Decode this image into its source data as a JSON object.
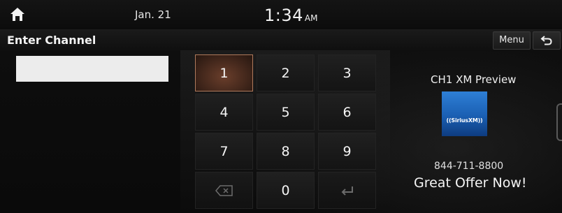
{
  "status": {
    "date": "Jan. 21",
    "time": "1:34",
    "ampm": "AM"
  },
  "header": {
    "title": "Enter Channel",
    "menu_label": "Menu"
  },
  "input": {
    "value": "",
    "placeholder": ""
  },
  "keypad": {
    "k1": "1",
    "k2": "2",
    "k3": "3",
    "k4": "4",
    "k5": "5",
    "k6": "6",
    "k7": "7",
    "k8": "8",
    "k9": "9",
    "k0": "0",
    "active_key": "1"
  },
  "channel": {
    "name": "CH1 XM Preview",
    "logo_text": "((SiriusXM))",
    "phone": "844-711-8800",
    "offer": "Great Offer Now!"
  },
  "colors": {
    "accent_key": "#6a3e2b",
    "logo_blue": "#2e7fd6",
    "background": "#0b0b0b"
  },
  "icons": {
    "home": "home-icon",
    "back": "back-arrow-icon",
    "delete": "backspace-icon",
    "enter": "enter-icon"
  }
}
